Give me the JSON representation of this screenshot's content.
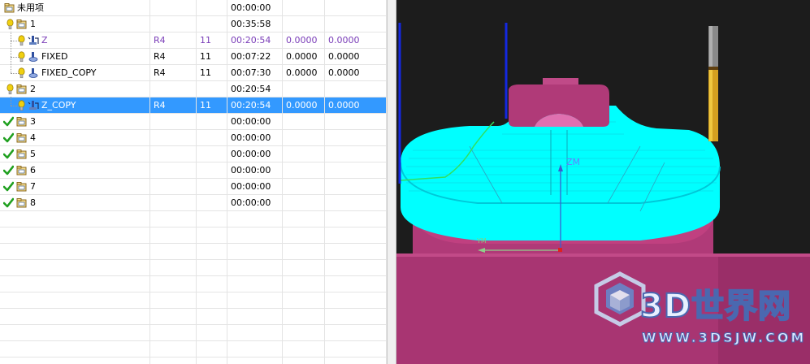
{
  "tree": {
    "rows": [
      {
        "name": "未用项",
        "kind": "group",
        "status": "none",
        "time": "00:00:00"
      },
      {
        "name": "1",
        "kind": "group",
        "status": "warn",
        "time": "00:35:58"
      },
      {
        "name": "Z",
        "kind": "op-zlevel",
        "status": "warn",
        "tool": "R4",
        "num": "11",
        "time": "00:20:54",
        "stock1": "0.0000",
        "stock2": "0.0000",
        "purple": true
      },
      {
        "name": "FIXED",
        "kind": "op-fixed",
        "status": "warn",
        "tool": "R4",
        "num": "11",
        "time": "00:07:22",
        "stock1": "0.0000",
        "stock2": "0.0000"
      },
      {
        "name": "FIXED_COPY",
        "kind": "op-fixed",
        "status": "warn",
        "tool": "R4",
        "num": "11",
        "time": "00:07:30",
        "stock1": "0.0000",
        "stock2": "0.0000"
      },
      {
        "name": "2",
        "kind": "group",
        "status": "warn",
        "time": "00:20:54"
      },
      {
        "name": "Z_COPY",
        "kind": "op-zlevel",
        "status": "warn",
        "tool": "R4",
        "num": "11",
        "time": "00:20:54",
        "stock1": "0.0000",
        "stock2": "0.0000",
        "selected": true
      },
      {
        "name": "3",
        "kind": "group",
        "status": "ok",
        "time": "00:00:00"
      },
      {
        "name": "4",
        "kind": "group",
        "status": "ok",
        "time": "00:00:00"
      },
      {
        "name": "5",
        "kind": "group",
        "status": "ok",
        "time": "00:00:00"
      },
      {
        "name": "6",
        "kind": "group",
        "status": "ok",
        "time": "00:00:00"
      },
      {
        "name": "7",
        "kind": "group",
        "status": "ok",
        "time": "00:00:00"
      },
      {
        "name": "8",
        "kind": "group",
        "status": "ok",
        "time": "00:00:00"
      }
    ],
    "empty_rows": 10
  },
  "viewport": {
    "axis_z_label": "ZM",
    "axis_y_label": "YM",
    "watermark_title": "3D世界网",
    "watermark_url": "WWW.3DSJW.COM",
    "colors": {
      "toolpath": "#00ffff",
      "part": "#b03a78",
      "tool_holder": "#d4a020",
      "axis": "#3a5fd0"
    }
  }
}
